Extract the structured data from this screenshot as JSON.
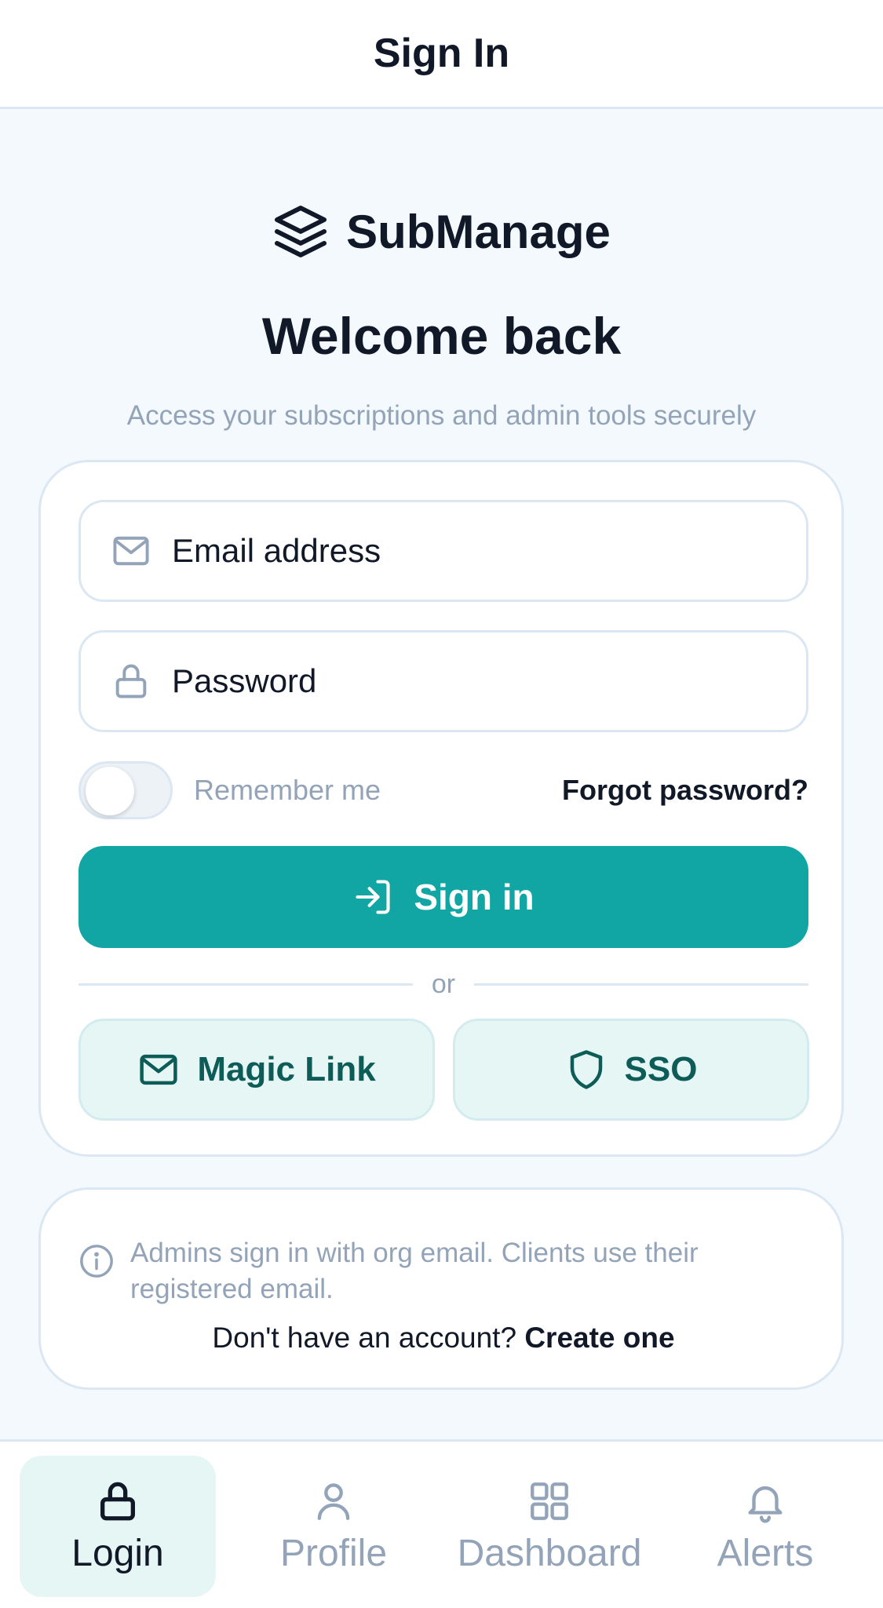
{
  "header": {
    "title": "Sign In"
  },
  "brand": {
    "name": "SubManage",
    "icon": "layers-icon"
  },
  "hero": {
    "title": "Welcome back",
    "subtitle": "Access your subscriptions and admin tools securely"
  },
  "form": {
    "email": {
      "label": "Email address",
      "icon": "mail-icon"
    },
    "password": {
      "label": "Password",
      "icon": "lock-icon"
    },
    "remember_label": "Remember me",
    "remember_on": false,
    "forgot_label": "Forgot password?",
    "signin_label": "Sign in",
    "divider_label": "or",
    "magic_link_label": "Magic Link",
    "sso_label": "SSO"
  },
  "info": {
    "text": "Admins sign in with org email. Clients use their registered email.",
    "account_prompt": "Don't have an account?",
    "create_label": "Create one"
  },
  "nav": {
    "items": [
      {
        "label": "Login",
        "icon": "lock-icon",
        "active": true
      },
      {
        "label": "Profile",
        "icon": "user-icon",
        "active": false
      },
      {
        "label": "Dashboard",
        "icon": "grid-icon",
        "active": false
      },
      {
        "label": "Alerts",
        "icon": "bell-icon",
        "active": false
      }
    ]
  },
  "colors": {
    "accent": "#11a5a4",
    "accent_soft": "#e6f6f5",
    "muted_text": "#93a3b8",
    "border": "#dbe7f3",
    "background": "#f4f9fd"
  }
}
